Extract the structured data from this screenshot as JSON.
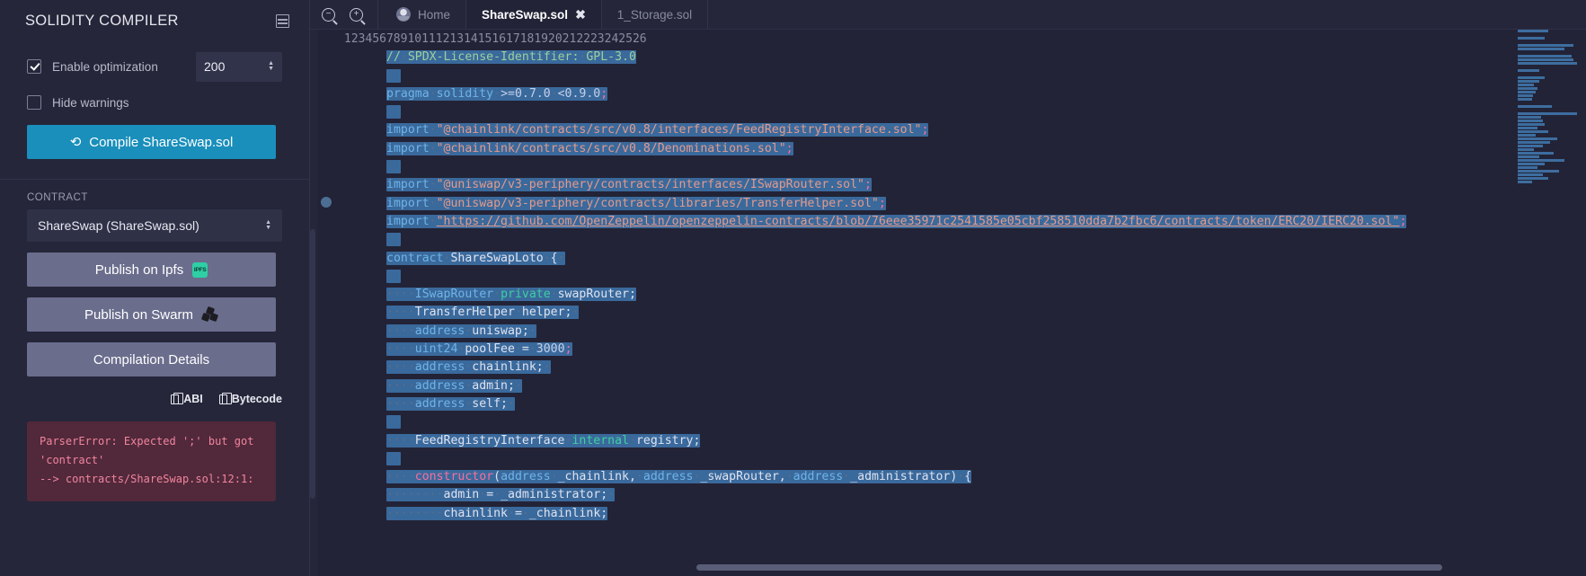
{
  "sidebar": {
    "title": "SOLIDITY COMPILER",
    "panel_toggle_icon": "panel-layout-icon",
    "options": [
      {
        "label": "Enable optimization",
        "checked": true
      },
      {
        "label": "Hide warnings",
        "checked": false
      }
    ],
    "runs_value": "200",
    "compile_button": "Compile ShareSwap.sol",
    "compile_icon": "refresh-icon",
    "compile_color": "#1a8fbb",
    "contract_label": "CONTRACT",
    "contract_selected": "ShareSwap (ShareSwap.sol)",
    "publish_ipfs": "Publish on Ipfs",
    "ipfs_badge_text": "IPFS",
    "publish_swarm": "Publish on Swarm",
    "compilation_details": "Compilation Details",
    "copy_abi": "ABI",
    "copy_bytecode": "Bytecode",
    "error": {
      "line1": "ParserError: Expected ';' but got",
      "line2": "'contract'",
      "line3": "--> contracts/ShareSwap.sol:12:1:",
      "bg": "#51293a",
      "fg": "#f2849f"
    }
  },
  "toolbar": {
    "zoom_out_icon": "zoom-out-icon",
    "zoom_in_icon": "zoom-in-icon"
  },
  "tabs": [
    {
      "label": "Home",
      "icon": "remix-home-icon",
      "active": false,
      "closable": false
    },
    {
      "label": "ShareSwap.sol",
      "active": true,
      "closable": true,
      "close_icon": "close-icon"
    },
    {
      "label": "1_Storage.sol",
      "active": false,
      "closable": false
    }
  ],
  "editor": {
    "breakpoint_line": 10,
    "selection_color": "#3a699c",
    "lines": [
      {
        "n": 1,
        "text": "// SPDX-License-Identifier: GPL-3.0"
      },
      {
        "n": 2,
        "text": ""
      },
      {
        "n": 3,
        "text": "pragma solidity >=0.7.0 <0.9.0;"
      },
      {
        "n": 4,
        "text": ""
      },
      {
        "n": 5,
        "text": "import \"@chainlink/contracts/src/v0.8/interfaces/FeedRegistryInterface.sol\";"
      },
      {
        "n": 6,
        "text": "import \"@chainlink/contracts/src/v0.8/Denominations.sol\";"
      },
      {
        "n": 7,
        "text": ""
      },
      {
        "n": 8,
        "text": "import \"@uniswap/v3-periphery/contracts/interfaces/ISwapRouter.sol\";"
      },
      {
        "n": 9,
        "text": "import \"@uniswap/v3-periphery/contracts/libraries/TransferHelper.sol\";"
      },
      {
        "n": 10,
        "text": "import \"https://github.com/OpenZeppelin/openzeppelin-contracts/blob/76eee35971c2541585e05cbf258510dda7b2fbc6/contracts/token/ERC20/IERC20.sol\";"
      },
      {
        "n": 11,
        "text": ""
      },
      {
        "n": 12,
        "text": "contract ShareSwapLoto {"
      },
      {
        "n": 13,
        "text": ""
      },
      {
        "n": 14,
        "text": "    ISwapRouter private swapRouter;"
      },
      {
        "n": 15,
        "text": "    TransferHelper helper;"
      },
      {
        "n": 16,
        "text": "    address uniswap;"
      },
      {
        "n": 17,
        "text": "    uint24 poolFee = 3000;"
      },
      {
        "n": 18,
        "text": "    address chainlink;"
      },
      {
        "n": 19,
        "text": "    address admin;"
      },
      {
        "n": 20,
        "text": "    address self;"
      },
      {
        "n": 21,
        "text": ""
      },
      {
        "n": 22,
        "text": "    FeedRegistryInterface internal registry;"
      },
      {
        "n": 23,
        "text": ""
      },
      {
        "n": 24,
        "text": "    constructor(address _chainlink, address _swapRouter, address _administrator) {"
      },
      {
        "n": 25,
        "text": "        admin = _administrator;"
      },
      {
        "n": 26,
        "text": "        chainlink = _chainlink;"
      }
    ]
  }
}
